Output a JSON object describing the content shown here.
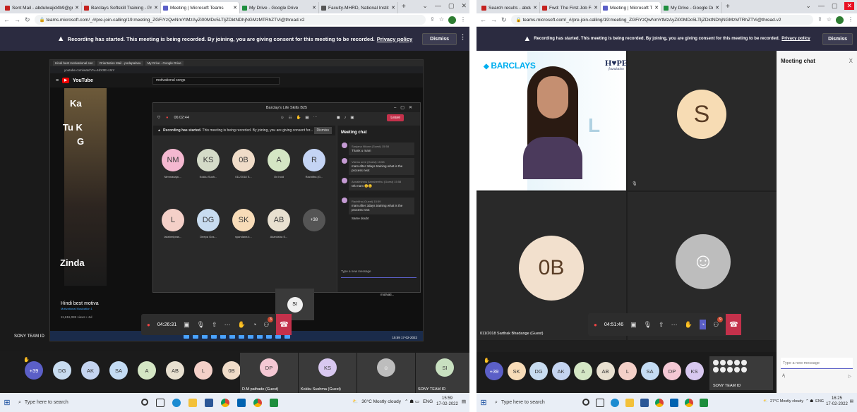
{
  "left": {
    "tabs": [
      {
        "label": "Sent Mail - abdulwajid4b9@gm",
        "color": "#c5221f"
      },
      {
        "label": "Barclays Softskill Training - Pre",
        "color": "#c5221f"
      },
      {
        "label": "Meeting | Microsoft Teams",
        "color": "#5b5fc7"
      },
      {
        "label": "My Drive - Google Drive",
        "color": "#1e8e3e"
      },
      {
        "label": "Faculty-MHRD, National Instituti",
        "color": "#555555"
      }
    ],
    "url": "teams.microsoft.com/_#/pre-join-calling/19:meeting_ZGFiYzQwNmYtMzAyZi00MDc5LTljZDktNDhjNGMzMTRhZTVi@thread.v2",
    "banner": {
      "text": "Recording has started. This meeting is being recorded. By joining, you are giving consent for this meeting to be recorded.",
      "link": "Privacy policy",
      "dismiss": "Dismiss"
    },
    "inner": {
      "tabs": [
        "Hindi best motivational son",
        "Orientation Mail - podapalasu",
        "My Drive - Google Drive"
      ],
      "url": "youtube.com/watch?v=4dX3EI-IJ4Y",
      "yt_brand": "YouTube",
      "search": "motivational songs",
      "thumb_lines": [
        "Ka",
        "Tu K",
        "G",
        "Zinda"
      ],
      "right_items": [
        "Kishore Kumar",
        "best motivational",
        "superhits songs...",
        "sic of India"
      ],
      "apply": "APPLY NOW",
      "video_channel": "Motivational Musication 1",
      "video_title": "Hindi best motiva",
      "video_views": "11,616,085 views • Jul",
      "time": "15:59",
      "date": "17-02-2022",
      "sidebar_video": "Best workout music | Top workout songs | Gym motivati..."
    },
    "teams": {
      "title": "Barclay's Life Skills B25",
      "timer": "06:02:44",
      "leave": "Leave",
      "recording": "Recording has started.",
      "recording_rest": "This meeting is being recorded. By joining, you are giving consent for...",
      "dismiss": "Dismiss",
      "participants": [
        {
          "initials": "NM",
          "name": "Nimmanaja ...",
          "color": "#f4b8d0"
        },
        {
          "initials": "KS",
          "name": "Kokku Sush...",
          "color": "#d4dbc8"
        },
        {
          "initials": "0B",
          "name": "011/2018 S...",
          "color": "#f0dcc8"
        },
        {
          "initials": "A",
          "name": "On hold",
          "color": "#d4e6c4"
        },
        {
          "initials": "R",
          "name": "Rachitha (G...",
          "color": "#c4d4f4"
        },
        {
          "initials": "L",
          "name": "lakshmipras...",
          "color": "#f4d0c8"
        },
        {
          "initials": "DG",
          "name": "Deepa Gos...",
          "color": "#c8dcf0"
        },
        {
          "initials": "SK",
          "name": "syandana k...",
          "color": "#f8dcb8"
        },
        {
          "initials": "AB",
          "name": "Akanksha S...",
          "color": "#e8e0d0"
        }
      ],
      "more": "+38",
      "chat_title": "Meeting chat",
      "messages": [
        {
          "who": "Sanjana Nikore (Guest)  15:58",
          "text": "Thank u mam"
        },
        {
          "who": "Vishnu sree (Guest)  15:58",
          "text": "mam after 3days training what is the process next"
        },
        {
          "who": "Annaleshmu Annalreethu (Guest)  15:58",
          "text": "Ok mam 😊😊"
        },
        {
          "who": "Rachitha (Guest)  15:59",
          "text": "mam after 3days training what is the process next"
        },
        {
          "who": "",
          "text": "Same doubt"
        }
      ],
      "input_placeholder": "Type a new message",
      "si": "SI"
    },
    "control": {
      "timer": "04:26:31",
      "badge": "3"
    },
    "sony": "SONY TEAM ID",
    "strip": [
      {
        "initials": "+39",
        "color": "#5b5fc7",
        "text": "#ffffff",
        "hand": true
      },
      {
        "initials": "DG",
        "color": "#c8dcf0"
      },
      {
        "initials": "AK",
        "color": "#c4d4f0"
      },
      {
        "initials": "SA",
        "color": "#c4dcf4"
      },
      {
        "initials": "A",
        "color": "#d4e6c4"
      },
      {
        "initials": "AB",
        "color": "#e8e0d0"
      },
      {
        "initials": "L",
        "color": "#f4d0c8"
      },
      {
        "initials": "0B",
        "color": "#f0dcc8"
      }
    ],
    "strip_tiles": [
      {
        "initials": "DP",
        "label": "D.M pathade (Guest)",
        "color": "#f4c8d4"
      },
      {
        "initials": "KS",
        "label": "Kokku Sushma (Guest)",
        "color": "#d8c8f0"
      },
      {
        "initials": "",
        "label": "",
        "color": "#bdbdbd"
      },
      {
        "initials": "SI",
        "label": "SONY TEAM ID",
        "color": "#c8e0c0"
      }
    ],
    "taskbar": {
      "search": "Type here to search",
      "weather": "30°C  Mostly cloudy",
      "lang": "ENG",
      "time": "15:59",
      "date": "17-02-2022"
    }
  },
  "right": {
    "tabs": [
      {
        "label": "Search results - abdulwajid4b9",
        "color": "#c5221f"
      },
      {
        "label": "Fwd: The First Job Fellowship - A",
        "color": "#c5221f"
      },
      {
        "label": "Meeting | Microsoft Teams",
        "color": "#5b5fc7"
      },
      {
        "label": "My Drive - Google Drive",
        "color": "#1e8e3e"
      }
    ],
    "url": "teams.microsoft.com/_#/pre-join-calling/19:meeting_ZGFiYzQwNmYtMzAyZi00MDc5LTljZDktNDhjNGMzMTRhZTVi@thread.v2",
    "banner": {
      "text": "Recording has started. This meeting is being recorded. By joining, you are giving consent for this meeting to be recorded.",
      "link": "Privacy policy",
      "dismiss": "Dismiss"
    },
    "barclays": "BARCLAYS",
    "hope": "H♥PE",
    "hope_sub": "foundation",
    "bg_text": "L",
    "tiles": [
      {
        "label": "SONY TEAM ID"
      },
      {
        "initials": "S",
        "label": ""
      },
      {
        "initials": "0B",
        "label": "011/2018 Sarthak Bhadange (Guest)"
      },
      {
        "initials": "",
        "label": ""
      }
    ],
    "control": {
      "timer": "04:51:46",
      "badge": "9"
    },
    "chat_title": "Meeting chat",
    "chat_close": "X",
    "input_placeholder": "Type a new message",
    "strip": [
      {
        "initials": "+39",
        "color": "#5b5fc7",
        "text": "#ffffff",
        "hand": true
      },
      {
        "initials": "SK",
        "color": "#f8dcb8"
      },
      {
        "initials": "DG",
        "color": "#c8dcf0"
      },
      {
        "initials": "AK",
        "color": "#c4d4f0"
      },
      {
        "initials": "A",
        "color": "#d4e6c4"
      },
      {
        "initials": "AB",
        "color": "#e8e0d0"
      },
      {
        "initials": "L",
        "color": "#f4d0c8"
      },
      {
        "initials": "SA",
        "color": "#c4dcf4"
      },
      {
        "initials": "DP",
        "color": "#f4c8d4"
      },
      {
        "initials": "KS",
        "color": "#d8c8f0"
      }
    ],
    "strip_label": "SONY TEAM ID",
    "taskbar": {
      "search": "Type here to search",
      "weather": "27°C  Mostly cloudy",
      "lang": "ENG",
      "time": "16:25",
      "date": "17-02-2022"
    }
  }
}
